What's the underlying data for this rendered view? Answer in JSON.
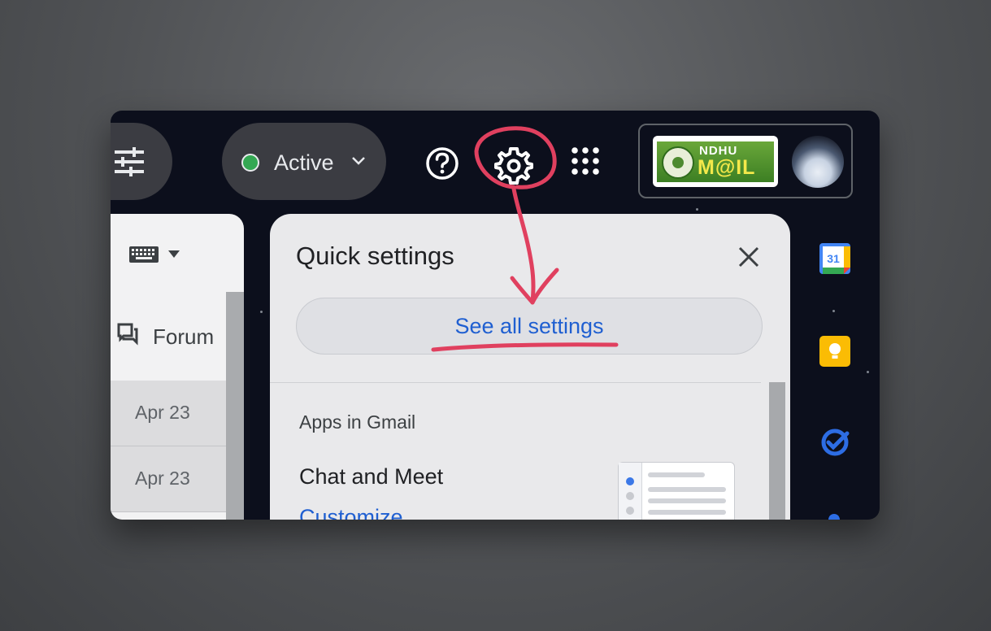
{
  "header": {
    "filter_icon": "tune-icon",
    "status_label": "Active",
    "status_color": "#34a853",
    "help_icon": "help-circle-icon",
    "settings_icon": "gear-icon",
    "apps_icon": "apps-grid-icon",
    "org_logo": {
      "line1": "NDHU",
      "line2": "M@IL"
    }
  },
  "mail_list": {
    "input_tools_icon": "keyboard-icon",
    "category_tab": "Forum",
    "rows": [
      {
        "date": "Apr 23"
      },
      {
        "date": "Apr 23"
      }
    ]
  },
  "quick_settings": {
    "title": "Quick settings",
    "close_icon": "close-icon",
    "see_all_label": "See all settings",
    "section_heading": "Apps in Gmail",
    "item_label": "Chat and Meet",
    "item_link": "Customize"
  },
  "side_rail": {
    "icons": [
      "calendar-icon",
      "keep-icon",
      "tasks-icon"
    ],
    "calendar_day": "31"
  },
  "annotation": {
    "color": "#e0405f"
  }
}
